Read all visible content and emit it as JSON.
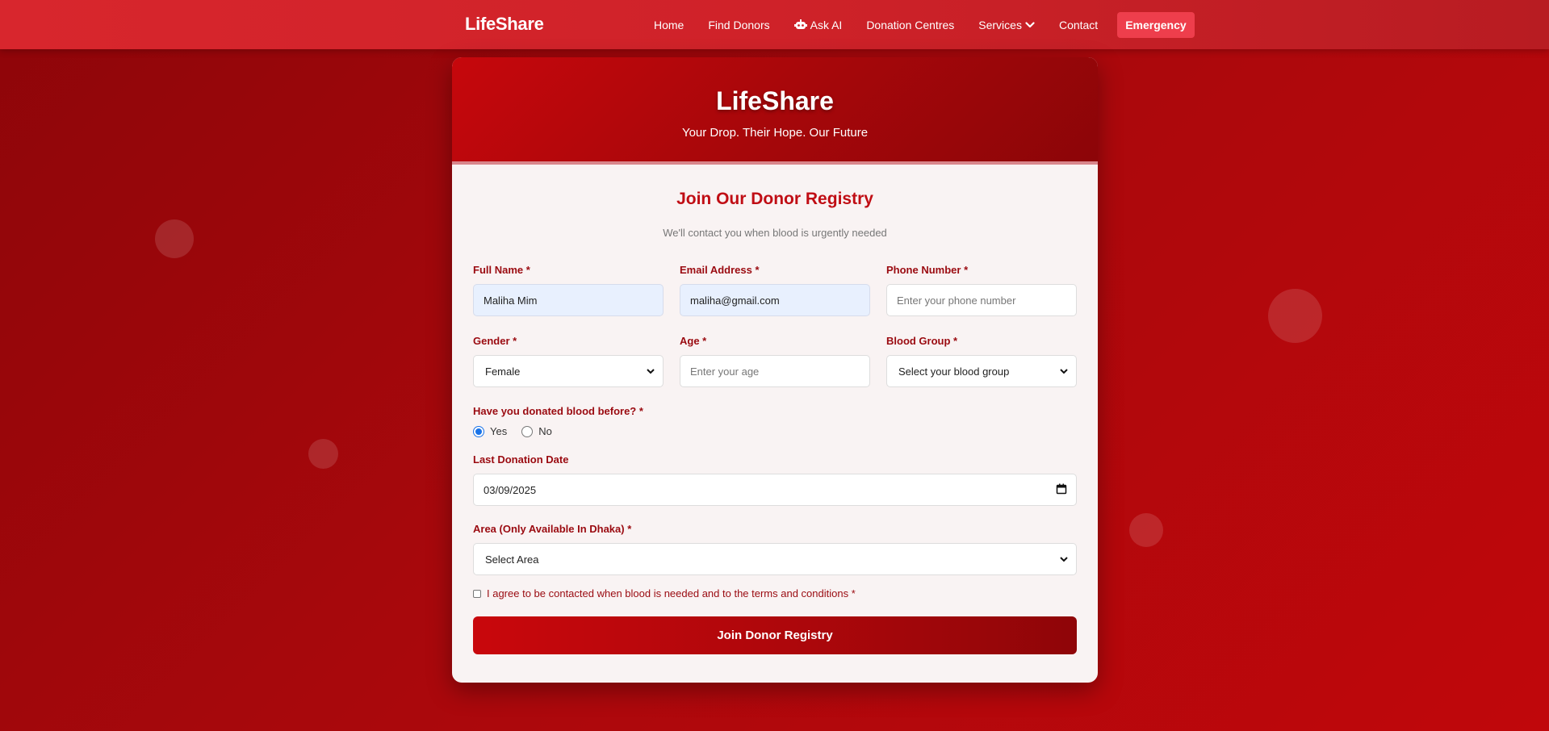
{
  "nav": {
    "brand": "LifeShare",
    "links": [
      "Home",
      "Find Donors",
      "Ask AI",
      "Donation Centres",
      "Services",
      "Contact"
    ],
    "emergency": "Emergency"
  },
  "card": {
    "title": "LifeShare",
    "tagline": "Your Drop. Their Hope. Our Future"
  },
  "form": {
    "title": "Join Our Donor Registry",
    "subtitle": "We'll contact you when blood is urgently needed",
    "full_name": {
      "label": "Full Name *",
      "value": "Maliha Mim"
    },
    "email": {
      "label": "Email Address *",
      "value": "maliha@gmail.com"
    },
    "phone": {
      "label": "Phone Number *",
      "placeholder": "Enter your phone number"
    },
    "gender": {
      "label": "Gender *",
      "value": "Female"
    },
    "age": {
      "label": "Age *",
      "placeholder": "Enter your age"
    },
    "blood_group": {
      "label": "Blood Group *",
      "value": "Select your blood group"
    },
    "donated_before": {
      "label": "Have you donated blood before? *",
      "options": [
        "Yes",
        "No"
      ],
      "selected": "Yes"
    },
    "last_donation": {
      "label": "Last Donation Date",
      "value": "03/09/2025"
    },
    "area": {
      "label": "Area (Only Available In Dhaka) *",
      "value": "Select Area"
    },
    "agree_text": "I agree to be contacted when blood is needed and to the terms and conditions *",
    "submit": "Join Donor Registry"
  },
  "colors": {
    "primary": "#c00d14",
    "accent": "#ee3e4c",
    "navbar": "#d8262d"
  }
}
